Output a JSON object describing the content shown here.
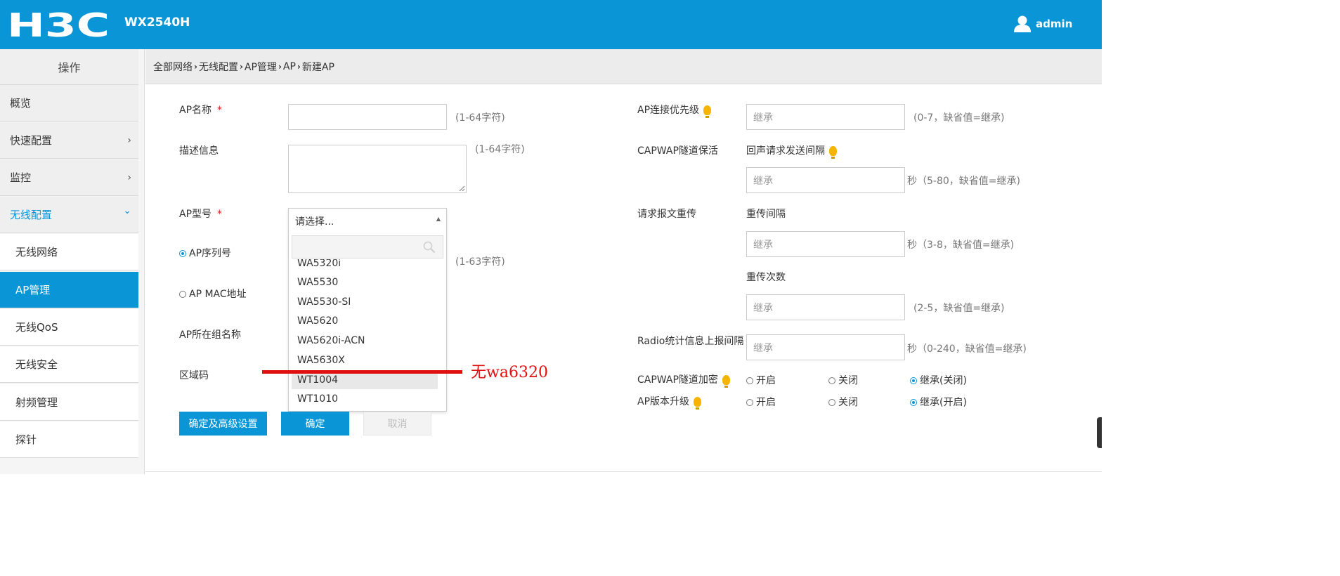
{
  "header": {
    "brand": "H3C",
    "model": "WX2540H",
    "user": "admin",
    "bg_color": "#0a96d6"
  },
  "sidebar": {
    "heading": "操作",
    "items": [
      {
        "label": "概览",
        "chevron": ""
      },
      {
        "label": "快速配置",
        "chevron": "›"
      },
      {
        "label": "监控",
        "chevron": "›"
      },
      {
        "label": "无线配置",
        "chevron": "⌄"
      },
      {
        "label": "无线网络"
      },
      {
        "label": "AP管理"
      },
      {
        "label": "无线QoS"
      },
      {
        "label": "无线安全"
      },
      {
        "label": "射频管理"
      },
      {
        "label": "探针"
      }
    ]
  },
  "breadcrumb": [
    "全部网络",
    "无线配置",
    "AP管理",
    "AP",
    "新建AP"
  ],
  "form_left": {
    "ap_name": {
      "label": "AP名称",
      "required": "*",
      "value": "",
      "hint": "(1-64字符)"
    },
    "description": {
      "label": "描述信息",
      "value": "",
      "hint": "(1-64字符)"
    },
    "ap_model": {
      "label": "AP型号",
      "required": "*",
      "selected": "请选择..."
    },
    "serial": {
      "label": "AP序列号",
      "hint": "(1-63字符)",
      "checked": true
    },
    "mac": {
      "label": "AP MAC地址",
      "checked": false
    },
    "group": {
      "label": "AP所在组名称"
    },
    "region": {
      "label": "区域码"
    }
  },
  "dropdown": {
    "search_placeholder": "",
    "options": [
      "WA5320i",
      "WA5530",
      "WA5530-SI",
      "WA5620",
      "WA5620i-ACN",
      "WA5630X",
      "WT1004",
      "WT1010"
    ],
    "highlighted": "WT1004"
  },
  "annotation": {
    "text": "无wa6320",
    "color": "#e01010"
  },
  "buttons": {
    "advanced": "确定及高级设置",
    "ok": "确定",
    "cancel": "取消"
  },
  "form_right": {
    "priority": {
      "label": "AP连接优先级",
      "placeholder": "继承",
      "hint": "(0-7，缺省值=继承)"
    },
    "keepalive": {
      "label": "CAPWAP隧道保活",
      "sub_label": "回声请求发送间隔",
      "placeholder": "继承",
      "hint": "秒（5-80，缺省值=继承)"
    },
    "retrans": {
      "label": "请求报文重传",
      "interval_label": "重传间隔",
      "interval_placeholder": "继承",
      "interval_hint": "秒（3-8，缺省值=继承)",
      "count_label": "重传次数",
      "count_placeholder": "继承",
      "count_hint": "(2-5，缺省值=继承)"
    },
    "radio_stats": {
      "label": "Radio统计信息上报间隔",
      "placeholder": "继承",
      "hint": "秒（0-240，缺省值=继承)"
    },
    "encrypt": {
      "label": "CAPWAP隧道加密",
      "opt_on": "开启",
      "opt_off": "关闭",
      "opt_inherit": "继承(关闭)",
      "selected": "继承(关闭)"
    },
    "upgrade": {
      "label": "AP版本升级",
      "opt_on": "开启",
      "opt_off": "关闭",
      "opt_inherit": "继承(开启)",
      "selected": "继承(开启)"
    }
  }
}
